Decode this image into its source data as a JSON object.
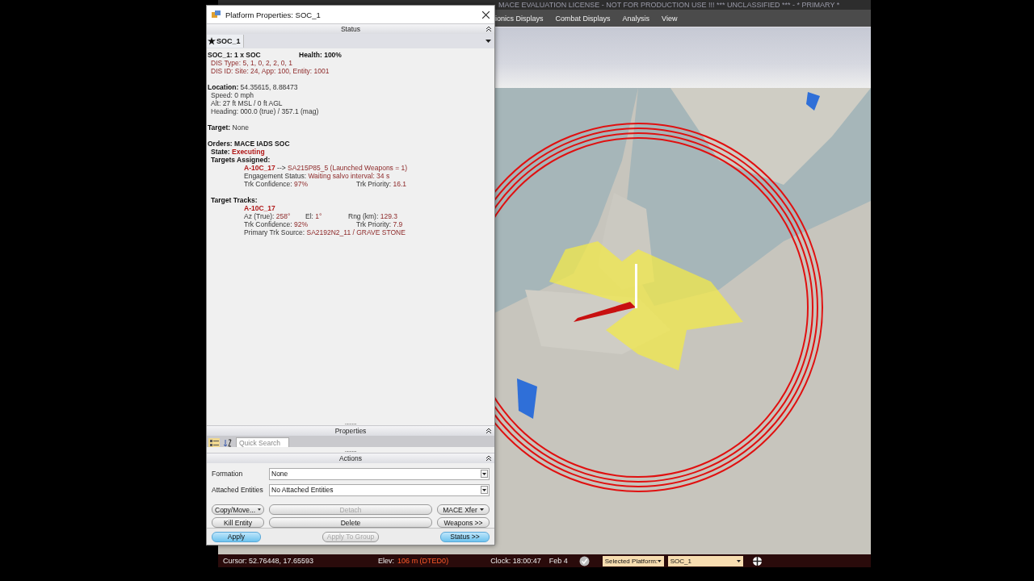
{
  "app": {
    "title": "MACE EVALUATION LICENSE - NOT FOR PRODUCTION USE !!! *** UNCLASSIFIED *** - * PRIMARY *",
    "menu": [
      "ionics Displays",
      "Combat Displays",
      "Analysis",
      "View"
    ],
    "status_bar": {
      "cursor": "Cursor: 52.76448, 17.65593",
      "elev_label": "Elev:",
      "elev_value": "106 m (DTED0)",
      "clock": "Clock: 18:00:47",
      "date": "Feb 4",
      "platform_select": "Selected Platform:",
      "platform_value": "SOC_1"
    }
  },
  "dialog": {
    "title": "Platform Properties: SOC_1",
    "status_header": "Status",
    "entity": "SOC_1",
    "sections": [
      {
        "lines": [
          {
            "kind": "top",
            "cells": [
              [
                {
                  "text": "SOC_1: 1 x SOC",
                  "kind": "bold"
                }
              ],
              [
                {
                  "text": "Health: 100%",
                  "kind": "bold"
                }
              ]
            ]
          },
          {
            "kind": "indent1",
            "cells": [
              [
                {
                  "text": "DIS Type: 5, 1, 0, 2, 2, 0, 1",
                  "kind": "value"
                }
              ]
            ]
          },
          {
            "kind": "indent1",
            "cells": [
              [
                {
                  "text": "DIS ID: Site: 24, App: 100, Entity: 1001",
                  "kind": "value"
                }
              ]
            ]
          }
        ]
      },
      {
        "lines": [
          {
            "kind": "top",
            "cells": [
              [
                {
                  "text": "Location:",
                  "kind": "bold"
                },
                {
                  "text": " 54.35615, 8.88473",
                  "kind": "plain"
                }
              ]
            ]
          },
          {
            "kind": "indent1",
            "cells": [
              [
                {
                  "text": "Speed: 0 mph",
                  "kind": "plain"
                }
              ]
            ]
          },
          {
            "kind": "indent1",
            "cells": [
              [
                {
                  "text": "Alt: 27 ft MSL / 0 ft AGL",
                  "kind": "plain"
                }
              ]
            ]
          },
          {
            "kind": "indent1",
            "cells": [
              [
                {
                  "text": "Heading: 000.0 (true) / 357.1 (mag)",
                  "kind": "plain"
                }
              ]
            ]
          }
        ]
      },
      {
        "lines": [
          {
            "kind": "top",
            "cells": [
              [
                {
                  "text": "Target:",
                  "kind": "bold"
                },
                {
                  "text": " None",
                  "kind": "plain"
                }
              ]
            ]
          }
        ]
      },
      {
        "lines": [
          {
            "kind": "top",
            "cells": [
              [
                {
                  "text": "Orders: MACE IADS SOC",
                  "kind": "bold"
                }
              ]
            ]
          },
          {
            "kind": "indent1",
            "cells": [
              [
                {
                  "text": "State:",
                  "kind": "bold"
                },
                {
                  "text": " Executing",
                  "kind": "alert"
                }
              ]
            ]
          },
          {
            "kind": "indent1",
            "cells": [
              [
                {
                  "text": "Targets Assigned:",
                  "kind": "bold"
                }
              ]
            ]
          },
          {
            "kind": "indent2",
            "cells": [
              [
                {
                  "text": "A-10C_17",
                  "kind": "alert"
                },
                {
                  "text": " --> ",
                  "kind": "plain"
                },
                {
                  "text": "SA215P85_5 (Launched Weapons = 1)",
                  "kind": "value"
                }
              ]
            ]
          },
          {
            "kind": "indent2",
            "cells": [
              [
                {
                  "text": "Engagement Status: ",
                  "kind": "plain"
                },
                {
                  "text": "Waiting salvo interval: 34 s",
                  "kind": "value"
                }
              ]
            ]
          },
          {
            "kind": "indent2",
            "cells": [
              [
                {
                  "text": "Trk Confidence: ",
                  "kind": "plain"
                },
                {
                  "text": "97%",
                  "kind": "value"
                }
              ],
              [
                {
                  "text": "Trk Priority: ",
                  "kind": "plain"
                },
                {
                  "text": "16.1",
                  "kind": "value"
                }
              ]
            ]
          }
        ]
      },
      {
        "lines": [
          {
            "kind": "indent1",
            "cells": [
              [
                {
                  "text": "Target Tracks:",
                  "kind": "bold"
                }
              ]
            ]
          },
          {
            "kind": "indent2",
            "cells": [
              [
                {
                  "text": "A-10C_17",
                  "kind": "alert"
                }
              ]
            ]
          },
          {
            "kind": "indent2",
            "cells": [
              [
                {
                  "text": "Az (True): ",
                  "kind": "plain"
                },
                {
                  "text": "258°",
                  "kind": "value"
                }
              ],
              [
                {
                  "text": "El: ",
                  "kind": "plain"
                },
                {
                  "text": "1°",
                  "kind": "value"
                }
              ],
              [
                {
                  "text": "Rng (km): ",
                  "kind": "plain"
                },
                {
                  "text": "129.3",
                  "kind": "value"
                }
              ]
            ]
          },
          {
            "kind": "indent2",
            "cells": [
              [
                {
                  "text": "Trk Confidence: ",
                  "kind": "plain"
                },
                {
                  "text": "92%",
                  "kind": "value"
                }
              ],
              [
                {
                  "text": "Trk Priority: ",
                  "kind": "plain"
                },
                {
                  "text": "7.9",
                  "kind": "value"
                }
              ]
            ]
          },
          {
            "kind": "indent2",
            "cells": [
              [
                {
                  "text": "Primary Trk Source: ",
                  "kind": "plain"
                },
                {
                  "text": "SA2192N2_11 / GRAVE STONE",
                  "kind": "value"
                }
              ]
            ]
          }
        ]
      }
    ],
    "splitter": "..........",
    "properties_header": "Properties",
    "search": {
      "placeholder": "Quick Search"
    },
    "actions_header": "Actions",
    "fields": [
      {
        "label": "Formation",
        "value": "None"
      },
      {
        "label": "Attached Entities",
        "value": "No Attached Entities"
      }
    ],
    "button_rows": [
      [
        {
          "label": "Copy/Move...",
          "kind": "menu",
          "disabled": false
        },
        {
          "label": "Detach",
          "kind": "wide",
          "disabled": true
        },
        {
          "label": "MACE  Xfer",
          "kind": "menu",
          "disabled": false
        }
      ],
      [
        {
          "label": "Kill Entity",
          "kind": "plain",
          "disabled": false
        },
        {
          "label": "Delete",
          "kind": "wide",
          "disabled": false
        },
        {
          "label": "Weapons >>",
          "kind": "plain",
          "disabled": false
        }
      ]
    ],
    "footer_buttons": [
      {
        "label": "Apply",
        "kind": "primary",
        "disabled": false
      },
      {
        "label": "Apply To Group",
        "kind": "plain",
        "disabled": true
      },
      {
        "label": "Status >>",
        "kind": "primary",
        "disabled": false
      }
    ]
  }
}
